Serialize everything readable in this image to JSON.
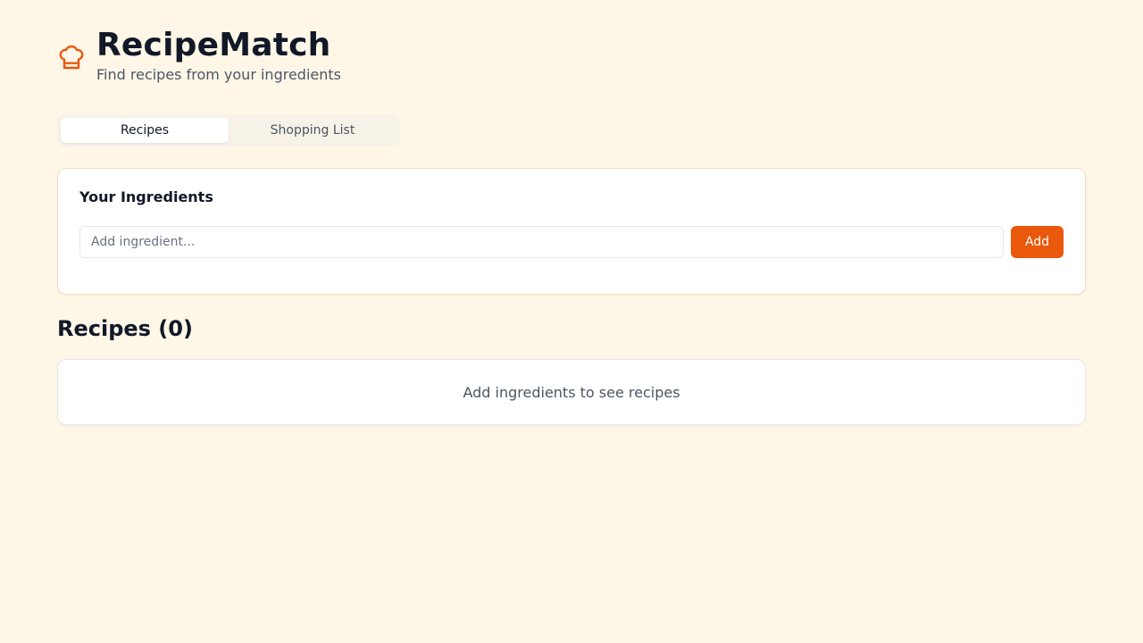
{
  "app": {
    "title": "RecipeMatch",
    "subtitle": "Find recipes from your ingredients",
    "logo_icon": "chef-hat-icon",
    "accent_color": "#ea580c"
  },
  "tabs": [
    {
      "label": "Recipes",
      "active": true
    },
    {
      "label": "Shopping List",
      "active": false
    }
  ],
  "ingredients": {
    "title": "Your Ingredients",
    "input_value": "",
    "input_placeholder": "Add ingredient...",
    "add_label": "Add"
  },
  "recipes": {
    "heading": "Recipes (0)",
    "empty_message": "Add ingredients to see recipes"
  }
}
